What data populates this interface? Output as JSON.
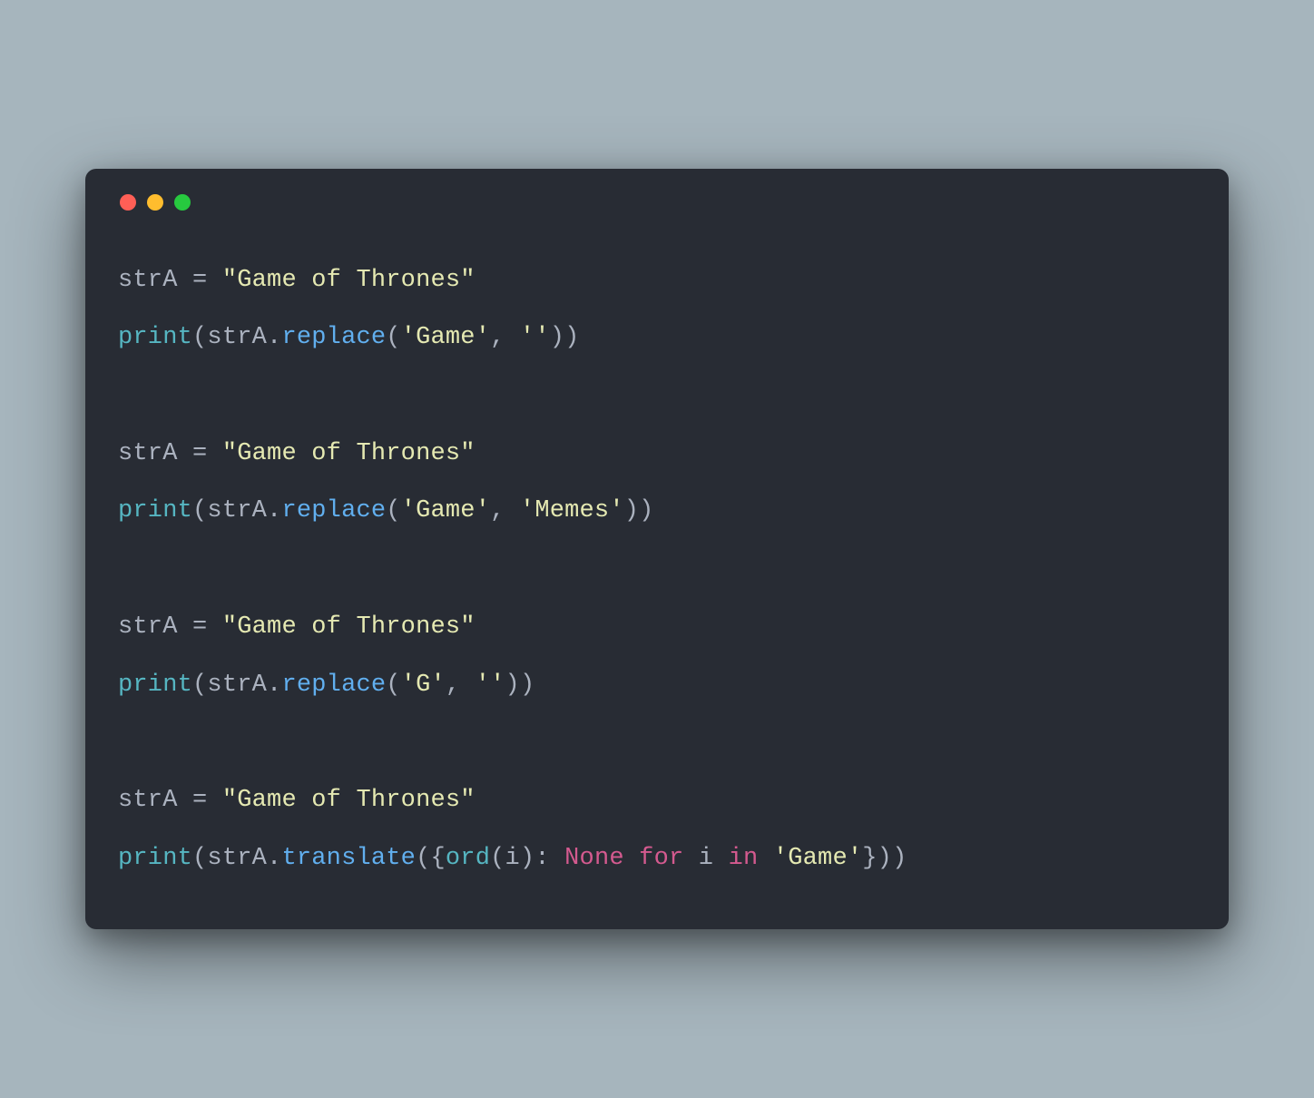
{
  "traffic_lights": {
    "red": "#ff5f56",
    "yellow": "#ffbd2e",
    "green": "#27c93f"
  },
  "code": {
    "blocks": [
      {
        "assign": {
          "var": "strA",
          "op": " = ",
          "str": "\"Game of Thrones\""
        },
        "call": {
          "print": "print",
          "open": "(",
          "obj": "strA",
          "dot": ".",
          "method": "replace",
          "open2": "(",
          "arg1": "'Game'",
          "comma": ", ",
          "arg2": "''",
          "close2": ")",
          "close": ")"
        }
      },
      {
        "assign": {
          "var": "strA",
          "op": " = ",
          "str": "\"Game of Thrones\""
        },
        "call": {
          "print": "print",
          "open": "(",
          "obj": "strA",
          "dot": ".",
          "method": "replace",
          "open2": "(",
          "arg1": "'Game'",
          "comma": ", ",
          "arg2": "'Memes'",
          "close2": ")",
          "close": ")"
        }
      },
      {
        "assign": {
          "var": "strA",
          "op": " = ",
          "str": "\"Game of Thrones\""
        },
        "call": {
          "print": "print",
          "open": "(",
          "obj": "strA",
          "dot": ".",
          "method": "replace",
          "open2": "(",
          "arg1": "'G'",
          "comma": ", ",
          "arg2": "''",
          "close2": ")",
          "close": ")"
        }
      },
      {
        "assign": {
          "var": "strA",
          "op": " = ",
          "str": "\"Game of Thrones\""
        },
        "call": {
          "print": "print",
          "open": "(",
          "obj": "strA",
          "dot": ".",
          "method": "translate",
          "open2": "(",
          "brace_open": "{",
          "ord": "ord",
          "ord_open": "(",
          "ord_arg": "i",
          "ord_close": ")",
          "colon": ": ",
          "none": "None",
          "sp1": " ",
          "for": "for",
          "sp2": " ",
          "loopvar": "i",
          "sp3": " ",
          "in": "in",
          "sp4": " ",
          "iter": "'Game'",
          "brace_close": "}",
          "close2": ")",
          "close": ")"
        }
      }
    ]
  }
}
